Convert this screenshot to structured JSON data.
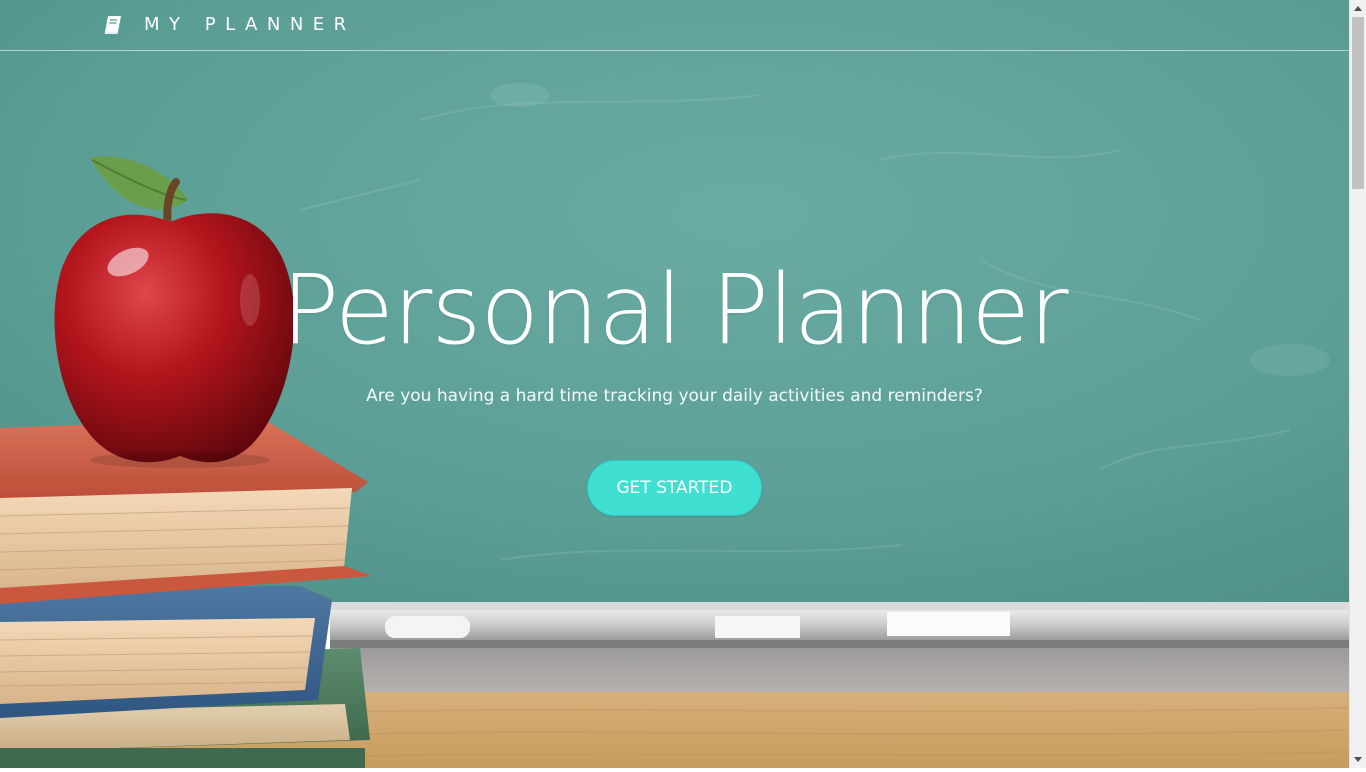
{
  "navbar": {
    "brand_icon": "book-icon",
    "brand_text": "MY PLANNER"
  },
  "hero": {
    "title": "Personal Planner",
    "subtitle": "Are you having a hard time tracking your daily activities and reminders?",
    "cta_label": "GET STARTED"
  },
  "colors": {
    "chalkboard": "#5c9f96",
    "cta": "#3fe0d1",
    "apple": "#b3141c",
    "text": "#ffffff"
  }
}
